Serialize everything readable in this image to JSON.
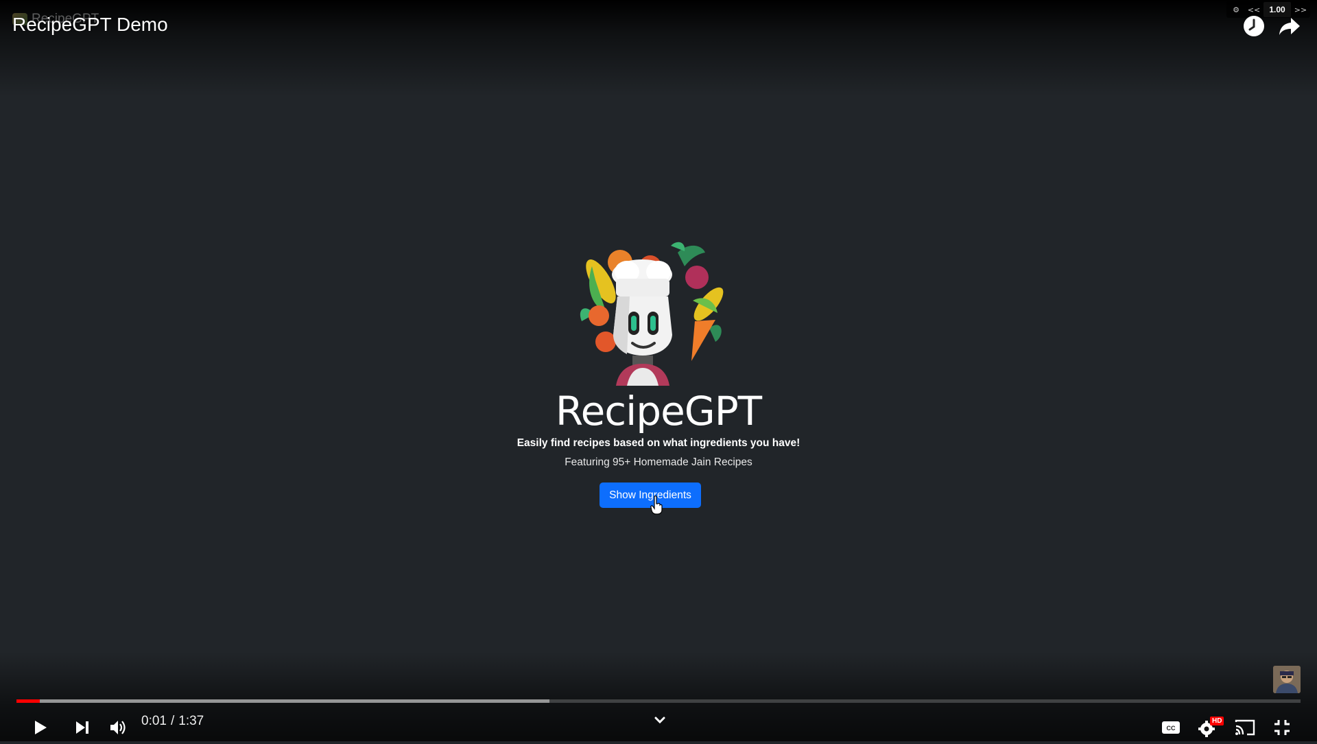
{
  "video": {
    "title": "RecipeGPT Demo",
    "channel_ghost": "RecipeGPT",
    "time_current": "0:01",
    "time_separator": "/",
    "time_total": "1:37",
    "played_fraction": 0.018,
    "loaded_fraction": 0.415,
    "badge_hd": "HD"
  },
  "speed_extension": {
    "slower": "<<",
    "value": "1.00",
    "faster": ">>"
  },
  "app": {
    "title": "RecipeGPT",
    "tagline": "Easily find recipes based on what ingredients you have!",
    "subtitle": "Featuring 95+ Homemade Jain Recipes",
    "button_label": "Show Ingredients",
    "button_color": "#0d6efd"
  },
  "colors": {
    "background": "#212529",
    "progress_played": "#ff0000",
    "accent_button": "#0d6efd"
  },
  "icons": {
    "top": [
      "gear-icon",
      "watch-later-icon",
      "share-icon"
    ],
    "controls": [
      "play-icon",
      "next-icon",
      "volume-icon",
      "chevron-down-icon",
      "captions-icon",
      "settings-icon",
      "cast-icon",
      "exit-fullscreen-icon"
    ]
  }
}
